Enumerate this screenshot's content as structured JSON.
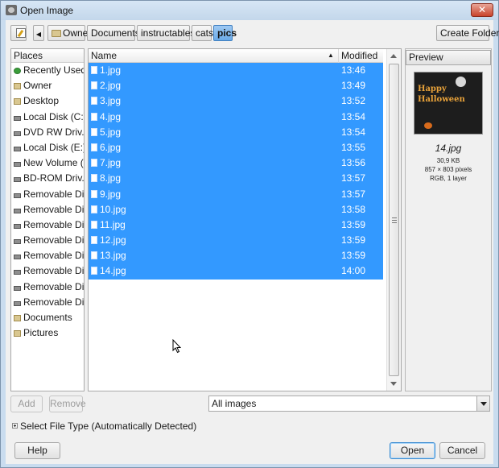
{
  "window": {
    "title": "Open Image",
    "close_label": "✕"
  },
  "pathbar": {
    "crumbs": [
      "Owner",
      "Documents",
      "instructables",
      "cats",
      "pics"
    ],
    "active": "pics",
    "create_folder_label": "Create Folder"
  },
  "places": {
    "header": "Places",
    "items": [
      {
        "label": "Recently Used",
        "icon": "recent-icon"
      },
      {
        "label": "Owner",
        "icon": "folder-icon"
      },
      {
        "label": "Desktop",
        "icon": "folder-icon"
      },
      {
        "label": "Local Disk (C:)",
        "icon": "drive-icon"
      },
      {
        "label": "DVD RW Driv...",
        "icon": "drive-icon"
      },
      {
        "label": "Local Disk (E:)",
        "icon": "drive-icon"
      },
      {
        "label": "New Volume (...",
        "icon": "drive-icon"
      },
      {
        "label": "BD-ROM Driv...",
        "icon": "drive-icon"
      },
      {
        "label": "Removable Di...",
        "icon": "drive-icon"
      },
      {
        "label": "Removable Di...",
        "icon": "drive-icon"
      },
      {
        "label": "Removable Di...",
        "icon": "drive-icon"
      },
      {
        "label": "Removable Di...",
        "icon": "drive-icon"
      },
      {
        "label": "Removable Di...",
        "icon": "drive-icon"
      },
      {
        "label": "Removable Di...",
        "icon": "drive-icon"
      },
      {
        "label": "Removable Di...",
        "icon": "drive-icon"
      },
      {
        "label": "Removable Di...",
        "icon": "drive-icon"
      },
      {
        "label": "Documents",
        "icon": "folder-icon"
      },
      {
        "label": "Pictures",
        "icon": "folder-icon"
      }
    ],
    "add_label": "Add",
    "remove_label": "Remove"
  },
  "files": {
    "col_name": "Name",
    "col_modified": "Modified",
    "sort_indicator": "▲",
    "rows": [
      {
        "name": "1.jpg",
        "modified": "13:46"
      },
      {
        "name": "2.jpg",
        "modified": "13:49"
      },
      {
        "name": "3.jpg",
        "modified": "13:52"
      },
      {
        "name": "4.jpg",
        "modified": "13:54"
      },
      {
        "name": "5.jpg",
        "modified": "13:54"
      },
      {
        "name": "6.jpg",
        "modified": "13:55"
      },
      {
        "name": "7.jpg",
        "modified": "13:56"
      },
      {
        "name": "8.jpg",
        "modified": "13:57"
      },
      {
        "name": "9.jpg",
        "modified": "13:57"
      },
      {
        "name": "10.jpg",
        "modified": "13:58"
      },
      {
        "name": "11.jpg",
        "modified": "13:59"
      },
      {
        "name": "12.jpg",
        "modified": "13:59"
      },
      {
        "name": "13.jpg",
        "modified": "13:59"
      },
      {
        "name": "14.jpg",
        "modified": "14:00"
      }
    ],
    "selection_color": "#3399ff"
  },
  "preview": {
    "header": "Preview",
    "thumb_text_line1": "Happy",
    "thumb_text_line2": "Halloween",
    "filename": "14.jpg",
    "size": "30,9 KB",
    "dimensions": "857 × 803 pixels",
    "mode": "RGB, 1 layer"
  },
  "filter": {
    "selected": "All images"
  },
  "file_type": {
    "label": "Select File Type (Automatically Detected)"
  },
  "buttons": {
    "help": "Help",
    "open": "Open",
    "cancel": "Cancel"
  }
}
